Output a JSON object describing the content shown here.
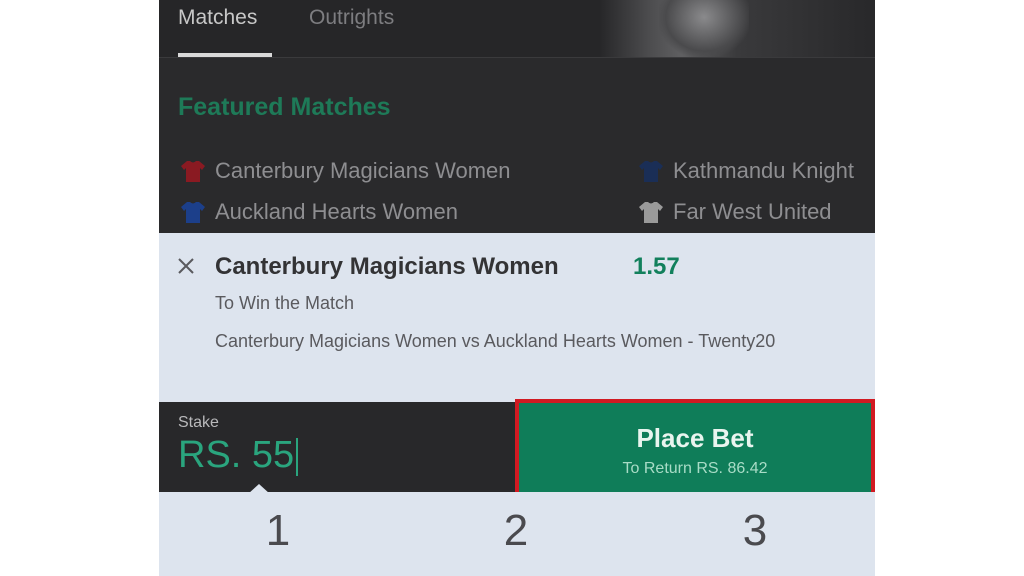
{
  "nav": {
    "tabs": [
      {
        "label": "Matches",
        "active": true
      },
      {
        "label": "Outrights",
        "active": false
      }
    ]
  },
  "featured": {
    "title": "Featured Matches",
    "match1": {
      "home": {
        "name": "Canterbury Magicians Women",
        "jersey_color": "#8a1a22"
      },
      "away": {
        "name": "Auckland Hearts Women",
        "jersey_color": "#1c3f8a"
      }
    },
    "match2": {
      "home": {
        "name": "Kathmandu Knight",
        "jersey_color": "#1a2e56"
      },
      "away": {
        "name": "Far West United",
        "jersey_color": "#9a9a9a"
      }
    }
  },
  "bet_slip": {
    "close_icon": "close-icon",
    "selection": "Canterbury Magicians Women",
    "odds": "1.57",
    "market": "To Win the Match",
    "event": "Canterbury Magicians Women vs Auckland Hearts Women - Twenty20"
  },
  "stake": {
    "label": "Stake",
    "value": "RS. 55"
  },
  "place_bet": {
    "label": "Place Bet",
    "sublabel": "To Return RS. 86.42"
  },
  "keypad": {
    "keys": [
      "1",
      "2",
      "3"
    ]
  },
  "colors": {
    "accent_green": "#0f7d59",
    "highlight_border": "#d11a22",
    "odds_green": "#12805c"
  }
}
